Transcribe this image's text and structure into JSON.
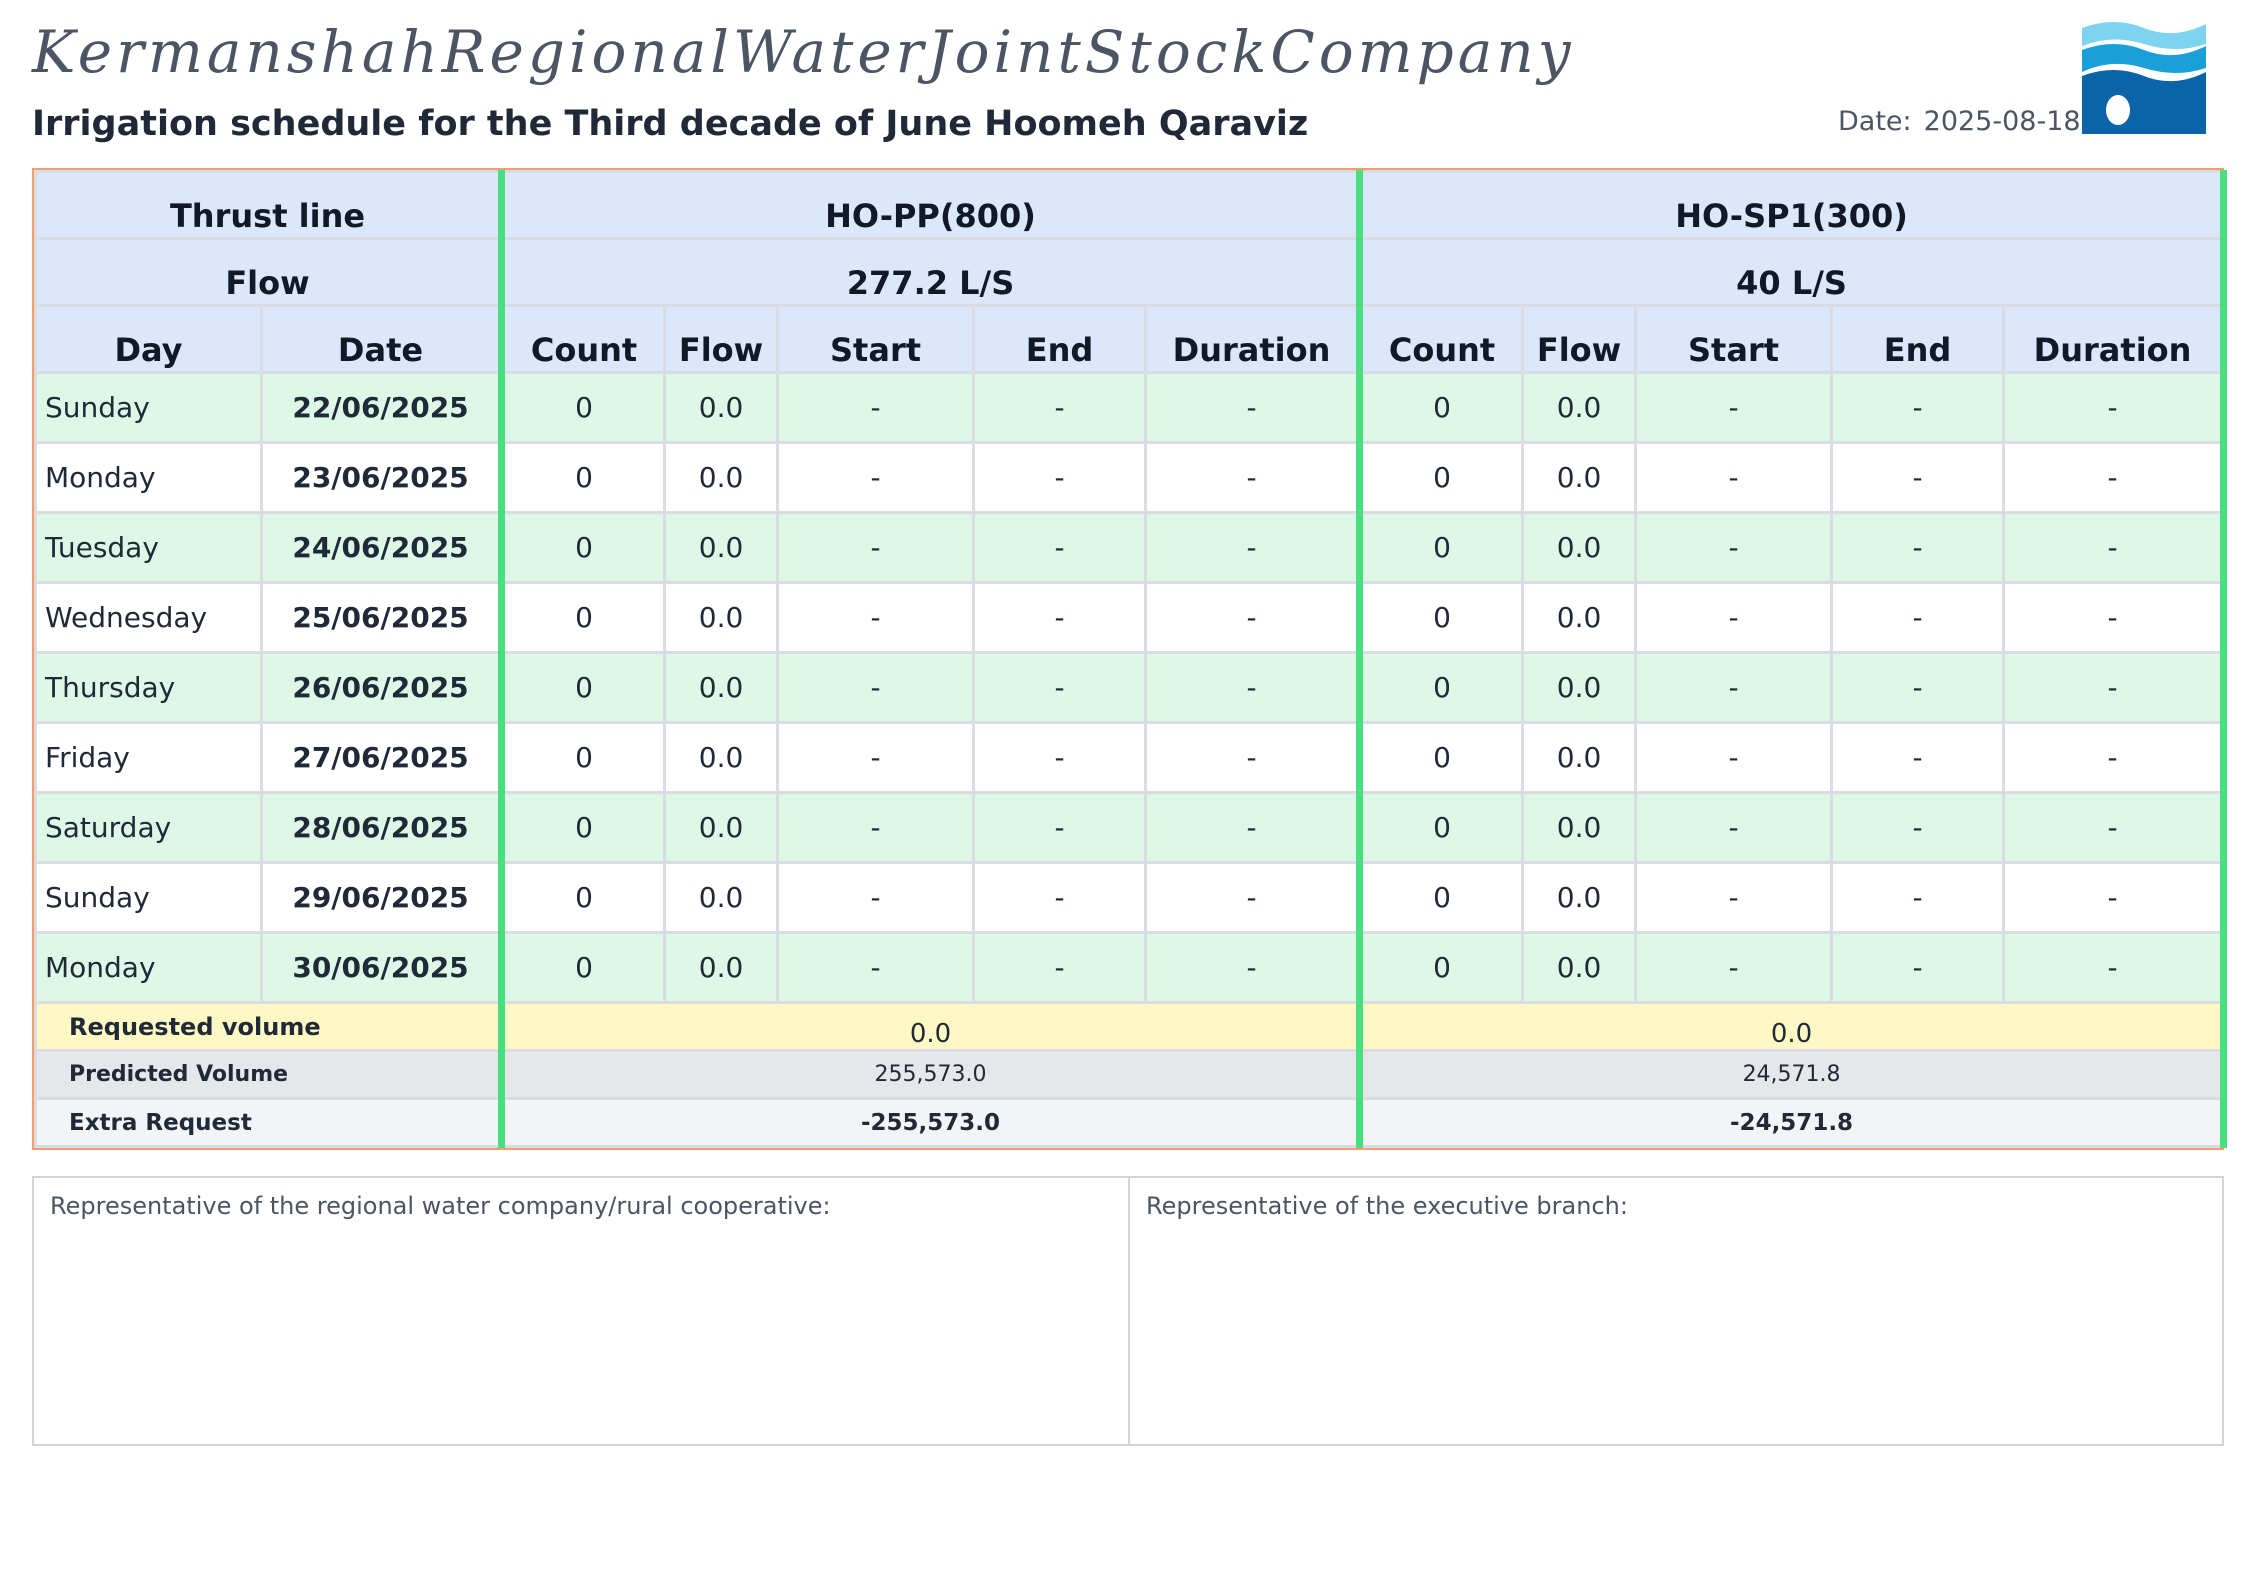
{
  "header": {
    "company": "KermanshahRegionalWaterJointStockCompany",
    "subtitle": "Irrigation schedule for the Third decade of June Hoomeh Qaraviz",
    "date_label": "Date:",
    "date_value": "2025-08-18",
    "logo_icon": "water-wave-logo-icon"
  },
  "table": {
    "thrust_label": "Thrust line",
    "flow_label": "Flow",
    "day_label": "Day",
    "date_label": "Date",
    "lines": [
      {
        "name": "HO-PP(800)",
        "flow": "277.2 L/S"
      },
      {
        "name": "HO-SP1(300)",
        "flow": "40 L/S"
      }
    ],
    "sub_headers": [
      "Count",
      "Flow",
      "Start",
      "End",
      "Duration"
    ],
    "rows": [
      {
        "day": "Sunday",
        "date": "22/06/2025",
        "a": [
          "0",
          "0.0",
          "-",
          "-",
          "-"
        ],
        "b": [
          "0",
          "0.0",
          "-",
          "-",
          "-"
        ]
      },
      {
        "day": "Monday",
        "date": "23/06/2025",
        "a": [
          "0",
          "0.0",
          "-",
          "-",
          "-"
        ],
        "b": [
          "0",
          "0.0",
          "-",
          "-",
          "-"
        ]
      },
      {
        "day": "Tuesday",
        "date": "24/06/2025",
        "a": [
          "0",
          "0.0",
          "-",
          "-",
          "-"
        ],
        "b": [
          "0",
          "0.0",
          "-",
          "-",
          "-"
        ]
      },
      {
        "day": "Wednesday",
        "date": "25/06/2025",
        "a": [
          "0",
          "0.0",
          "-",
          "-",
          "-"
        ],
        "b": [
          "0",
          "0.0",
          "-",
          "-",
          "-"
        ]
      },
      {
        "day": "Thursday",
        "date": "26/06/2025",
        "a": [
          "0",
          "0.0",
          "-",
          "-",
          "-"
        ],
        "b": [
          "0",
          "0.0",
          "-",
          "-",
          "-"
        ]
      },
      {
        "day": "Friday",
        "date": "27/06/2025",
        "a": [
          "0",
          "0.0",
          "-",
          "-",
          "-"
        ],
        "b": [
          "0",
          "0.0",
          "-",
          "-",
          "-"
        ]
      },
      {
        "day": "Saturday",
        "date": "28/06/2025",
        "a": [
          "0",
          "0.0",
          "-",
          "-",
          "-"
        ],
        "b": [
          "0",
          "0.0",
          "-",
          "-",
          "-"
        ]
      },
      {
        "day": "Sunday",
        "date": "29/06/2025",
        "a": [
          "0",
          "0.0",
          "-",
          "-",
          "-"
        ],
        "b": [
          "0",
          "0.0",
          "-",
          "-",
          "-"
        ]
      },
      {
        "day": "Monday",
        "date": "30/06/2025",
        "a": [
          "0",
          "0.0",
          "-",
          "-",
          "-"
        ],
        "b": [
          "0",
          "0.0",
          "-",
          "-",
          "-"
        ]
      }
    ],
    "summary": {
      "requested_label": "Requested volume",
      "requested": [
        "0.0",
        "0.0"
      ],
      "predicted_label": "Predicted Volume",
      "predicted": [
        "255,573.0",
        "24,571.8"
      ],
      "extra_label": "Extra Request",
      "extra": [
        "-255,573.0",
        "-24,571.8"
      ]
    }
  },
  "signatures": {
    "left": "Representative of the regional water company/rural cooperative:",
    "right": "Representative of the executive branch:"
  },
  "colors": {
    "header_bg": "#dbe8fb",
    "row_green": "#ddf8e6",
    "separator": "#4ade80",
    "requested_bg": "#fef8c4",
    "predicted_bg": "#e5e7eb",
    "frame": "#f59e6b"
  }
}
